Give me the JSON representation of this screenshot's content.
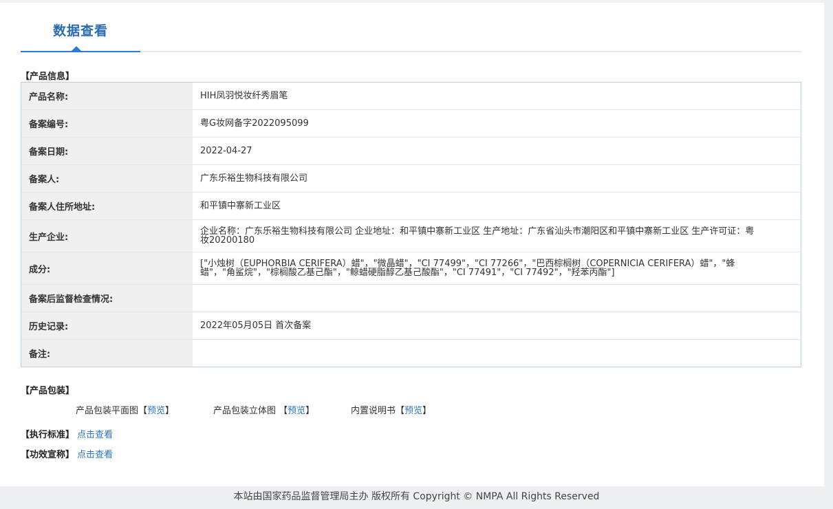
{
  "tab": {
    "title": "数据查看"
  },
  "sections": {
    "product_info": "【产品信息】",
    "packaging": "【产品包装】"
  },
  "product_rows": [
    {
      "label": "产品名称:",
      "value": "HIH凤羽悦妆纤秀眉笔"
    },
    {
      "label": "备案编号:",
      "value": "粤G妆网备字2022095099"
    },
    {
      "label": "备案日期:",
      "value": "2022-04-27"
    },
    {
      "label": "备案人:",
      "value": "广东乐裕生物科技有限公司"
    },
    {
      "label": "备案人住所地址:",
      "value": "和平镇中寨新工业区"
    },
    {
      "label": "生产企业:",
      "value": "企业名称：广东乐裕生物科技有限公司 企业地址：和平镇中寨新工业区 生产地址：广东省汕头市潮阳区和平镇中寨新工业区 生产许可证：粤妆20200180"
    },
    {
      "label": "成分:",
      "value": "[\"小烛树（EUPHORBIA CERIFERA）蜡\"，\"微晶蜡\"，\"CI 77499\"，\"CI 77266\"，\"巴西棕榈树（COPERNICIA CERIFERA）蜡\"，\"蜂蜡\"，\"角鲨烷\"，\"棕榈酸乙基己酯\"，\"鲸蜡硬脂醇乙基己酸酯\"，\"CI 77491\"，\"CI 77492\"，\"羟苯丙酯\"]"
    },
    {
      "label": "备案后监督检查情况:",
      "value": ""
    },
    {
      "label": "历史记录:",
      "value": "2022年05月05日 首次备案"
    },
    {
      "label": "备注:",
      "value": ""
    }
  ],
  "packaging": [
    {
      "label": "产品包装平面图",
      "bracket_open": "【",
      "link": "预览",
      "bracket_close": "】"
    },
    {
      "label": "产品包装立体图 ",
      "bracket_open": "【",
      "link": "预览",
      "bracket_close": "】"
    },
    {
      "label": "内置说明书",
      "bracket_open": "【",
      "link": "预览",
      "bracket_close": "】"
    }
  ],
  "standard": {
    "label": "【执行标准】",
    "link": "点击查看"
  },
  "efficacy": {
    "label": "【功效宣称】",
    "link": "点击查看"
  },
  "footer": {
    "text": "本站由国家药品监督管理局主办 版权所有 Copyright © NMPA All Rights Reserved"
  }
}
